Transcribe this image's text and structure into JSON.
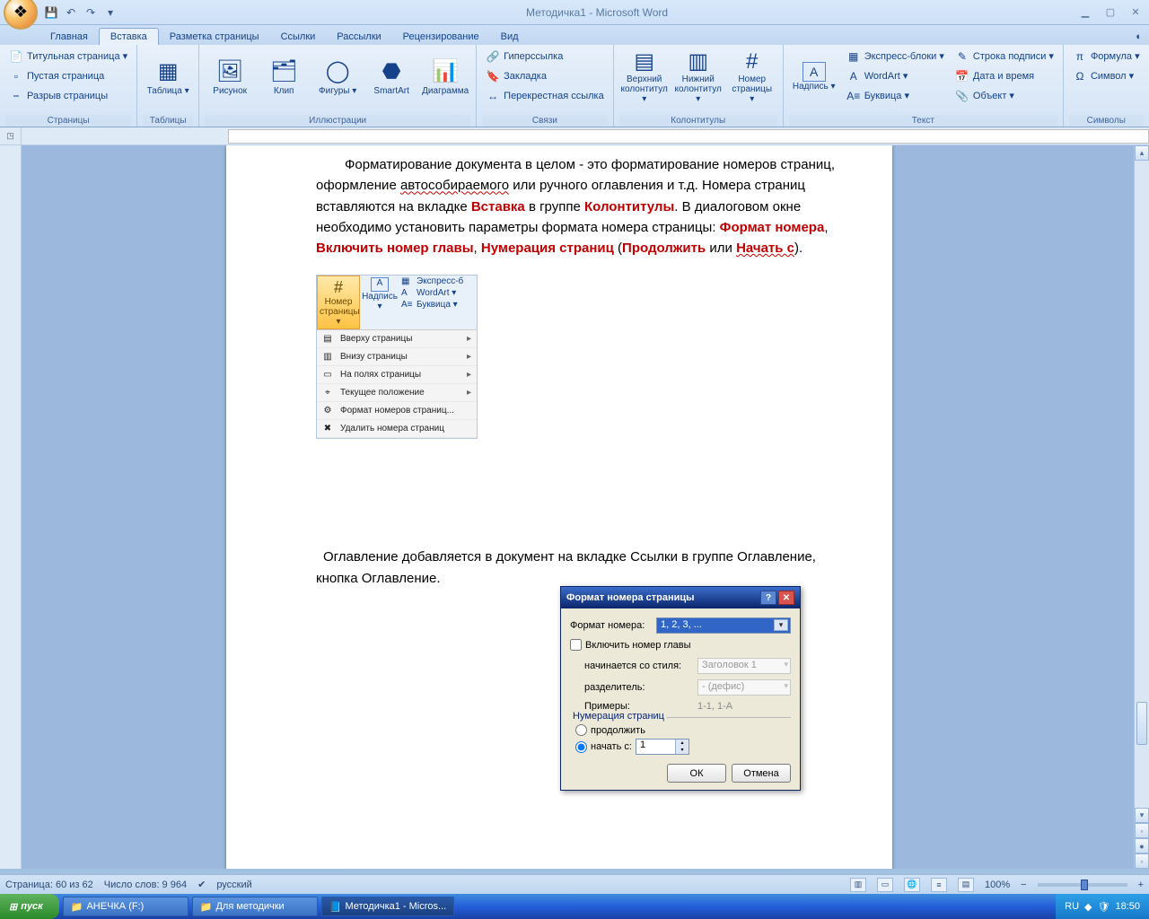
{
  "window": {
    "title": "Методичка1 - Microsoft Word"
  },
  "tabs": [
    "Главная",
    "Вставка",
    "Разметка страницы",
    "Ссылки",
    "Рассылки",
    "Рецензирование",
    "Вид"
  ],
  "activeTab": "Вставка",
  "ribbon": {
    "groups": [
      {
        "label": "Страницы",
        "type": "smallcol",
        "items": [
          {
            "icon": "📄",
            "text": "Титульная страница ▾"
          },
          {
            "icon": "▫",
            "text": "Пустая страница"
          },
          {
            "icon": "⎯",
            "text": "Разрыв страницы"
          }
        ]
      },
      {
        "label": "Таблицы",
        "type": "big",
        "items": [
          {
            "icon": "▦",
            "text": "Таблица ▾"
          }
        ]
      },
      {
        "label": "Иллюстрации",
        "type": "big",
        "items": [
          {
            "icon": "🖼",
            "text": "Рисунок"
          },
          {
            "icon": "🗂",
            "text": "Клип"
          },
          {
            "icon": "◯",
            "text": "Фигуры ▾"
          },
          {
            "icon": "⬣",
            "text": "SmartArt"
          },
          {
            "icon": "📊",
            "text": "Диаграмма"
          }
        ]
      },
      {
        "label": "Связи",
        "type": "smallcol",
        "items": [
          {
            "icon": "🔗",
            "text": "Гиперссылка"
          },
          {
            "icon": "🔖",
            "text": "Закладка"
          },
          {
            "icon": "↔",
            "text": "Перекрестная ссылка"
          }
        ]
      },
      {
        "label": "Колонтитулы",
        "type": "big",
        "items": [
          {
            "icon": "▤",
            "text": "Верхний колонтитул ▾"
          },
          {
            "icon": "▥",
            "text": "Нижний колонтитул ▾"
          },
          {
            "icon": "#",
            "text": "Номер страницы ▾"
          }
        ]
      },
      {
        "label": "Текст",
        "type": "mixed",
        "big": [
          {
            "icon": "A",
            "text": "Надпись ▾"
          }
        ],
        "small": [
          {
            "icon": "▦",
            "text": "Экспресс-блоки ▾"
          },
          {
            "icon": "A",
            "text": "WordArt ▾"
          },
          {
            "icon": "A≡",
            "text": "Буквица ▾"
          }
        ],
        "small2": [
          {
            "icon": "✎",
            "text": "Строка подписи ▾"
          },
          {
            "icon": "📅",
            "text": "Дата и время"
          },
          {
            "icon": "📎",
            "text": "Объект ▾"
          }
        ]
      },
      {
        "label": "Символы",
        "type": "smallcol",
        "items": [
          {
            "icon": "π",
            "text": "Формула ▾"
          },
          {
            "icon": "Ω",
            "text": "Символ ▾"
          }
        ]
      }
    ]
  },
  "doc": {
    "p1a": "Форматирование документа в целом - это форматирование номеров страниц, оформление ",
    "p1b": "автособираемого",
    "p1c": " или ручного оглавления и т.д. Номера страниц вставляются на вкладке ",
    "vkladka": "Вставка",
    "p1d": " в группе ",
    "gruppa": "Колонтитулы",
    "p1e": ". В диалоговом окне необходимо установить параметры формата номера страницы: ",
    "f1": "Формат номера",
    "c1": ", ",
    "f2": "Включить номер главы",
    "c2": ", ",
    "f3": "Нумерация страниц",
    "p1f": " (",
    "f4": "Продолжить",
    "p1g": " или ",
    "f5": "Начать с",
    "p1h": ").",
    "p2": "Оглавление добавляется в документ на вкладке Ссылки в группе Оглавление, кнопка Оглавление."
  },
  "snippet": {
    "selected": {
      "icon": "#",
      "label": "Номер страницы ▾"
    },
    "nadpis": {
      "icon": "A",
      "label": "Надпись ▾"
    },
    "rows": [
      {
        "icon": "▦",
        "text": "Экспресс-б"
      },
      {
        "icon": "A",
        "text": "WordArt ▾"
      },
      {
        "icon": "A≡",
        "text": "Буквица ▾"
      }
    ],
    "menu": [
      {
        "icon": "▤",
        "text": "Вверху страницы",
        "arrow": true
      },
      {
        "icon": "▥",
        "text": "Внизу страницы",
        "arrow": true
      },
      {
        "icon": "▭",
        "text": "На полях страницы",
        "arrow": true
      },
      {
        "icon": "⌖",
        "text": "Текущее положение",
        "arrow": true
      },
      {
        "icon": "⚙",
        "text": "Формат номеров страниц...",
        "arrow": false
      },
      {
        "icon": "✖",
        "text": "Удалить номера страниц",
        "arrow": false
      }
    ]
  },
  "dialog": {
    "title": "Формат номера страницы",
    "format_lbl": "Формат номера:",
    "format_val": "1, 2, 3, ...",
    "include_chapter": "Включить номер главы",
    "starts_style_lbl": "начинается со стиля:",
    "starts_style_val": "Заголовок 1",
    "sep_lbl": "разделитель:",
    "sep_val": "-   (дефис)",
    "examples_lbl": "Примеры:",
    "examples_val": "1-1, 1-A",
    "numbering_legend": "Нумерация страниц",
    "continue": "продолжить",
    "start_from": "начать с:",
    "start_val": "1",
    "ok": "ОК",
    "cancel": "Отмена"
  },
  "status": {
    "page": "Страница: 60 из 62",
    "words": "Число слов: 9 964",
    "lang": "русский",
    "zoom": "100%"
  },
  "taskbar": {
    "start": "пуск",
    "tasks": [
      {
        "icon": "📁",
        "label": "AНЕЧКА (F:)"
      },
      {
        "icon": "📁",
        "label": "Для методички"
      },
      {
        "icon": "📘",
        "label": "Методичка1 - Micros...",
        "active": true
      }
    ],
    "lang": "RU",
    "time": "18:50"
  }
}
